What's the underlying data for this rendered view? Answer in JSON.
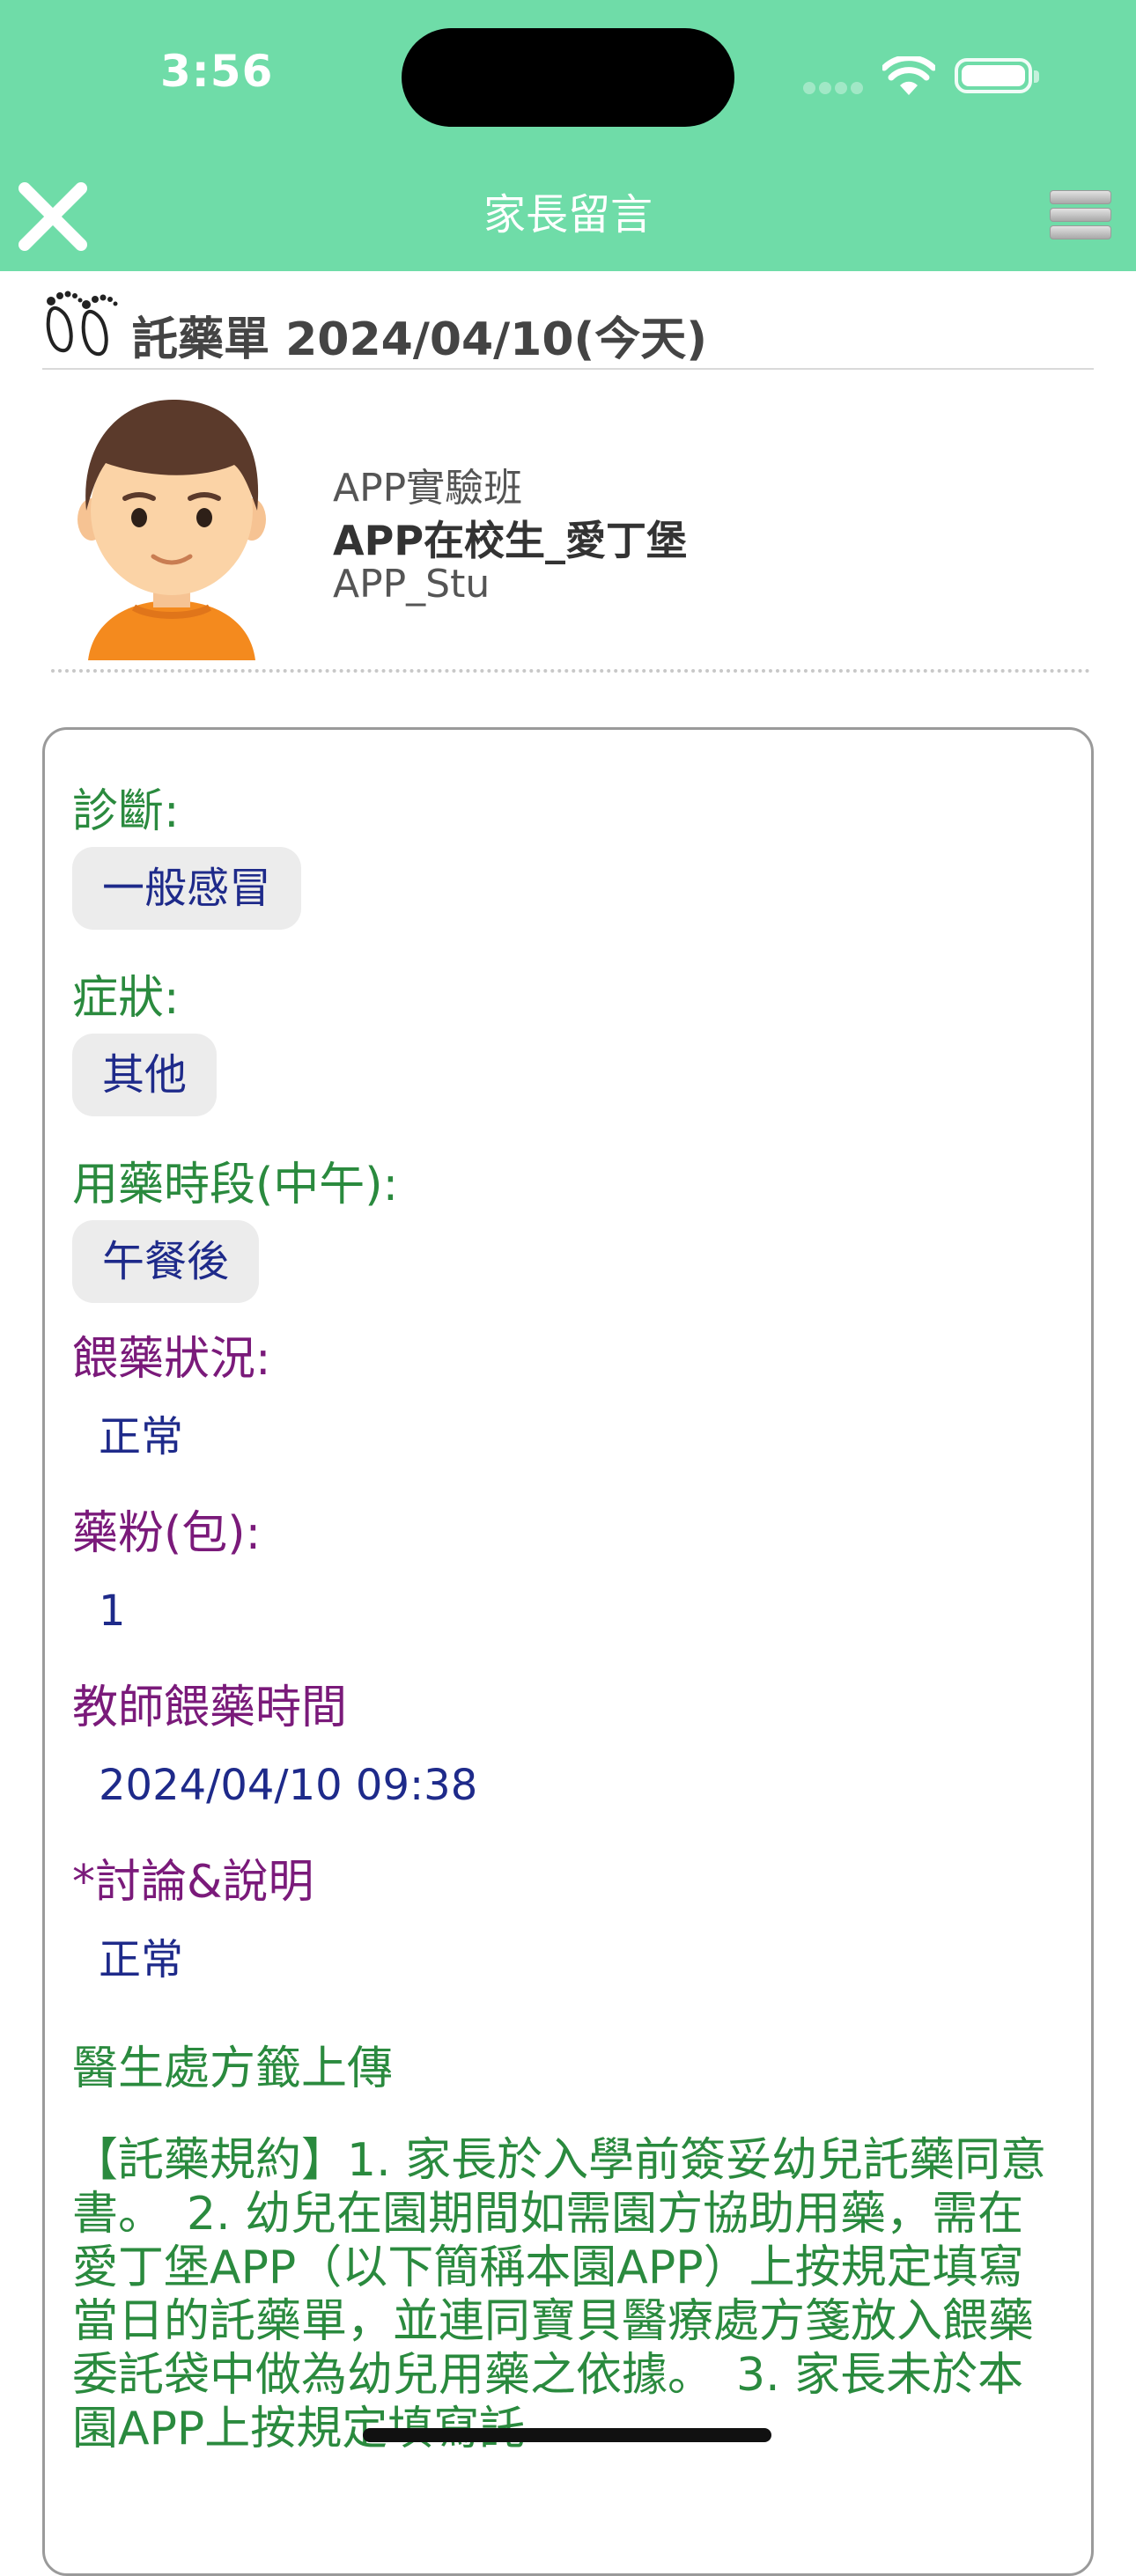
{
  "status_bar": {
    "time": "3:56"
  },
  "nav": {
    "title": "家長留言",
    "close_icon": "close-icon",
    "menu_icon": "menu-icon"
  },
  "record": {
    "title": "託藥單 2024/04/10(今天)"
  },
  "student": {
    "class_name": "APP實驗班",
    "name": "APP在校生_愛丁堡",
    "id": "APP_Stu"
  },
  "form": {
    "diagnosis_label": "診斷:",
    "diagnosis_value": "一般感冒",
    "symptom_label": "症狀:",
    "symptom_value": "其他",
    "time_slot_label": "用藥時段(中午):",
    "time_slot_value": "午餐後",
    "feeding_status_label": "餵藥狀況:",
    "feeding_status_value": "正常",
    "powder_label": "藥粉(包):",
    "powder_value": "1",
    "teacher_time_label": "教師餵藥時間",
    "teacher_time_value": "2024/04/10 09:38",
    "discussion_label": "*討論&說明",
    "discussion_value": "正常",
    "prescription_label": "醫生處方籤上傳",
    "notice_text": "【託藥規約】1. 家長於入學前簽妥幼兒託藥同意書。　2. 幼兒在園期間如需園方協助用藥，需在愛丁堡APP（以下簡稱本園APP）上按規定填寫當日的託藥單，並連同寶貝醫療處方箋放入餵藥委託袋中做為幼兒用藥之依據。　3. 家長未於本園APP上按規定填寫託"
  },
  "colors": {
    "header_green": "#6fdca8",
    "label_green": "#2a8a3e",
    "label_purple": "#7a1a7a",
    "value_blue": "#1e2a8a",
    "chip_bg": "#ececec"
  }
}
